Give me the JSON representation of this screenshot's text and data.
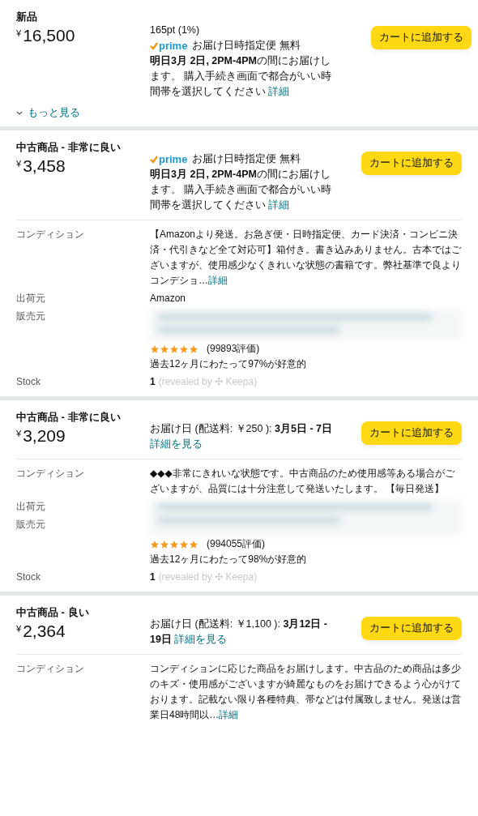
{
  "offers": [
    {
      "condition": "新品",
      "currency": "¥",
      "price": "16,500",
      "points": "165pt (1%)",
      "delivery": {
        "kind": "prime",
        "badge": "prime",
        "service": "お届け日時指定便 無料",
        "text": "**明日3月 2日, 2PM-4PM**の間にお届けします。 購入手続き画面で都合がいい時間帯を選択してください",
        "link": "詳細"
      },
      "button": "カートに追加する",
      "more_link": "もっと見る"
    },
    {
      "condition": "中古商品 - 非常に良い",
      "currency": "¥",
      "price": "3,458",
      "delivery": {
        "kind": "prime",
        "badge": "prime",
        "service": "お届け日時指定便 無料",
        "text": "**明日3月 2日, 2PM-4PM**の間にお届けします。 購入手続き画面で都合がいい時間帯を選択してください",
        "link": "詳細"
      },
      "button": "カートに追加する",
      "condition_row": {
        "label": "コンディション",
        "text": "【Amazonより発送。お急ぎ便・日時指定便、カード決済・コンビニ決済・代引きなど全て対応可】箱付き。書き込みありません。古本ではございますが、使用感少なくきれいな状態の書籍です。弊社基準で良よりコンデショ…",
        "link": "詳細"
      },
      "seller": {
        "labels": [
          "出荷元",
          "販売元"
        ],
        "shipper": "Amazon",
        "stars": 5,
        "ratings": "(99893評価)",
        "positive": "過去12ヶ月にわたって97%が好意的"
      },
      "stock": {
        "label": "Stock",
        "value": "1",
        "note": "(revealed by ✣ Keepa)"
      }
    },
    {
      "condition": "中古商品 - 非常に良い",
      "currency": "¥",
      "price": "3,209",
      "delivery": {
        "kind": "date",
        "text": "お届け日 (配送料: ￥250 ): **3月5日 - 7日**",
        "link": "詳細を見る"
      },
      "button": "カートに追加する",
      "condition_row": {
        "label": "コンディション",
        "text": "◆◆◆非常にきれいな状態です。中古商品のため使用感等ある場合がございますが、品質には十分注意して発送いたします。 【毎日発送】"
      },
      "seller": {
        "labels": [
          "出荷元",
          "販売元"
        ],
        "stars": 5,
        "ratings": "(994055評価)",
        "positive": "過去12ヶ月にわたって98%が好意的"
      },
      "stock": {
        "label": "Stock",
        "value": "1",
        "note": "(revealed by ✣ Keepa)"
      }
    },
    {
      "condition": "中古商品 - 良い",
      "currency": "¥",
      "price": "2,364",
      "delivery": {
        "kind": "date",
        "text": "お届け日 (配送料: ￥1,100 ): **3月12日 - 19日**",
        "link": "詳細を見る"
      },
      "button": "カートに追加する",
      "condition_row": {
        "label": "コンディション",
        "text": "コンディションに応じた商品をお届けします。中古品のため商品は多少のキズ・使用感がございますが綺麗なものをお届けできるよう心がけております。記載ない限り各種特典、帯などは付属致しません。発送は営業日48時間以…",
        "link": "詳細"
      }
    }
  ]
}
